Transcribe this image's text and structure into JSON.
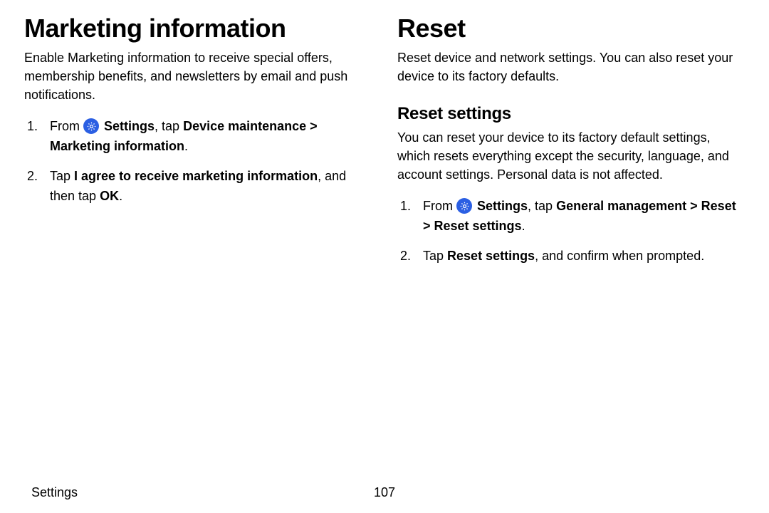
{
  "left": {
    "heading": "Marketing information",
    "intro": "Enable Marketing information to receive special offers, membership benefits, and newsletters by email and push notifications.",
    "step1": {
      "from": "From",
      "settings": "Settings",
      "tap": ", tap ",
      "path1": "Device maintenance",
      "gt": " > ",
      "path2": "Marketing information",
      "dot": "."
    },
    "step2": {
      "tap": "Tap ",
      "agree": "I agree to receive marketing information",
      "mid": ", and then tap ",
      "ok": "OK",
      "dot": "."
    }
  },
  "right": {
    "heading": "Reset",
    "intro": "Reset device and network settings. You can also reset your device to its factory defaults.",
    "sub": "Reset settings",
    "subintro": "You can reset your device to its factory default settings, which resets everything except the security, language, and account settings. Personal data is not affected.",
    "step1": {
      "from": "From",
      "settings": "Settings",
      "tap": ", tap ",
      "path1": "General management",
      "gt1": " > ",
      "path2": "Reset",
      "gt2": " > ",
      "path3": "Reset settings",
      "dot": "."
    },
    "step2": {
      "tap": "Tap ",
      "rs": "Reset settings",
      "tail": ", and confirm when prompted."
    }
  },
  "footer": {
    "section": "Settings",
    "page": "107"
  }
}
